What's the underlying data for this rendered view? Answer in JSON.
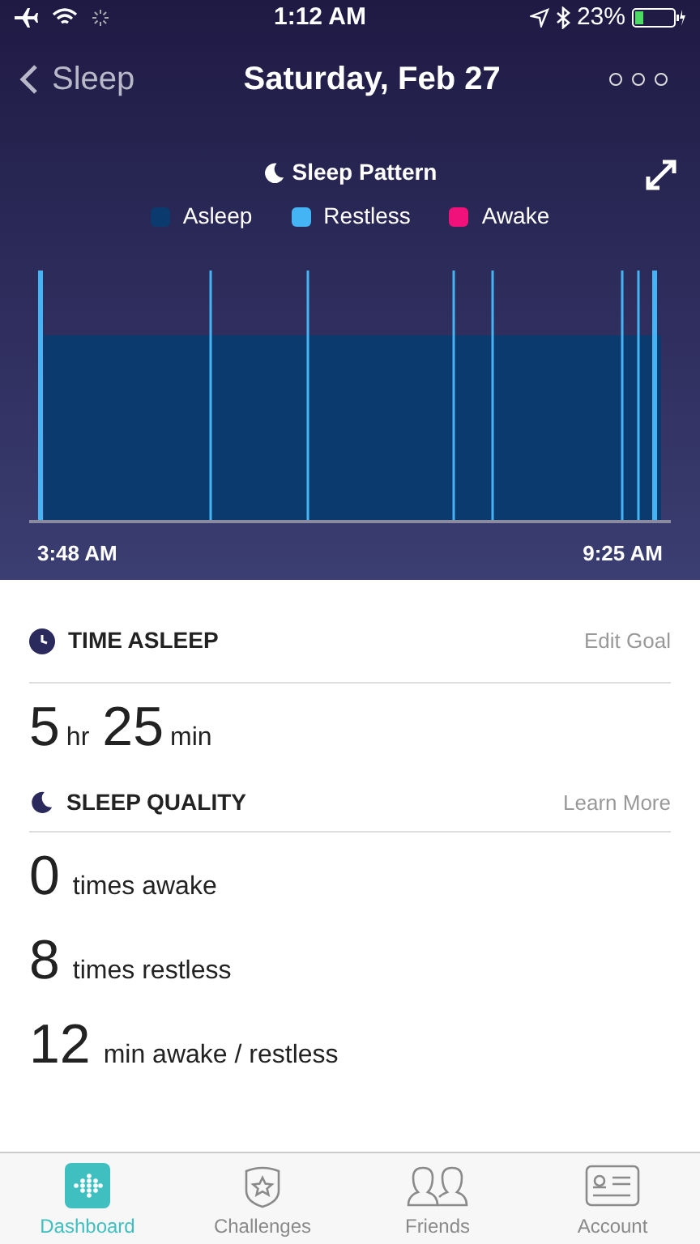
{
  "status_bar": {
    "time": "1:12 AM",
    "battery": "23%"
  },
  "nav": {
    "back": "Sleep",
    "title": "Saturday, Feb 27"
  },
  "chart": {
    "title": "Sleep Pattern",
    "legend": [
      {
        "label": "Asleep",
        "color": "#0a3a6e"
      },
      {
        "label": "Restless",
        "color": "#45b4f5"
      },
      {
        "label": "Awake",
        "color": "#f0127a"
      }
    ],
    "start": "3:48 AM",
    "end": "9:25 AM"
  },
  "time_asleep": {
    "title": "TIME ASLEEP",
    "action": "Edit Goal",
    "parts": [
      {
        "value": "5",
        "unit": "hr"
      },
      {
        "value": "25",
        "unit": "min"
      }
    ]
  },
  "sleep_quality": {
    "title": "SLEEP QUALITY",
    "action": "Learn More",
    "rows": [
      {
        "value": "0",
        "label": "times awake"
      },
      {
        "value": "8",
        "label": "times restless"
      },
      {
        "value": "12",
        "label": "min awake / restless"
      }
    ]
  },
  "tabs": [
    {
      "label": "Dashboard",
      "kind": "dashboard",
      "selected": true
    },
    {
      "label": "Challenges",
      "kind": "challenges",
      "selected": false
    },
    {
      "label": "Friends",
      "kind": "friends",
      "selected": false
    },
    {
      "label": "Account",
      "kind": "account",
      "selected": false
    }
  ]
}
